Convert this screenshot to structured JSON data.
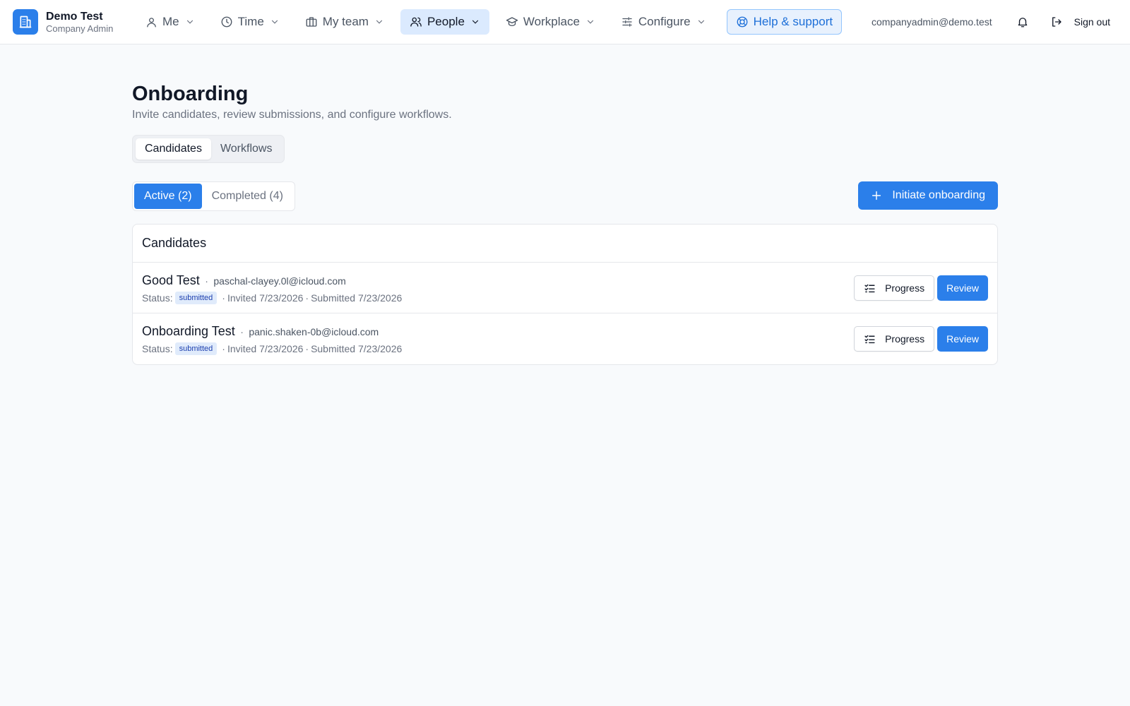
{
  "brand": {
    "name": "Demo Test",
    "role": "Company Admin",
    "icon": "building-icon"
  },
  "nav": {
    "items": [
      {
        "label": "Me",
        "icon": "user-icon"
      },
      {
        "label": "Time",
        "icon": "clock-icon"
      },
      {
        "label": "My team",
        "icon": "briefcase-icon"
      },
      {
        "label": "People",
        "icon": "users-icon",
        "active": true
      },
      {
        "label": "Workplace",
        "icon": "graduation-cap-icon"
      },
      {
        "label": "Configure",
        "icon": "sliders-icon"
      }
    ],
    "help": {
      "label": "Help & support",
      "icon": "lifebuoy-icon"
    }
  },
  "user": {
    "email": "companyadmin@demo.test",
    "signout_label": "Sign out"
  },
  "page": {
    "title": "Onboarding",
    "subtitle": "Invite candidates, review submissions, and configure workflows."
  },
  "section_tabs": [
    {
      "label": "Candidates",
      "active": true
    },
    {
      "label": "Workflows",
      "active": false
    }
  ],
  "status_tabs": [
    {
      "label": "Active (2)",
      "active": true
    },
    {
      "label": "Completed (4)",
      "active": false
    }
  ],
  "initiate_button": {
    "label": "Initiate onboarding"
  },
  "candidates": {
    "title": "Candidates",
    "status_label": "Status:",
    "progress_label": "Progress",
    "review_label": "Review",
    "separator": "·",
    "rows": [
      {
        "name": "Good Test",
        "email": "paschal-clayey.0l@icloud.com",
        "status": "submitted",
        "invited": "Invited 7/23/2026",
        "submitted": "Submitted 7/23/2026"
      },
      {
        "name": "Onboarding Test",
        "email": "panic.shaken-0b@icloud.com",
        "status": "submitted",
        "invited": "Invited 7/23/2026",
        "submitted": "Submitted 7/23/2026"
      }
    ]
  },
  "colors": {
    "accent": "#2b7fea",
    "active_nav_bg": "#dbeafe",
    "badge_bg": "#e0ebfb",
    "badge_text": "#1e40af"
  }
}
